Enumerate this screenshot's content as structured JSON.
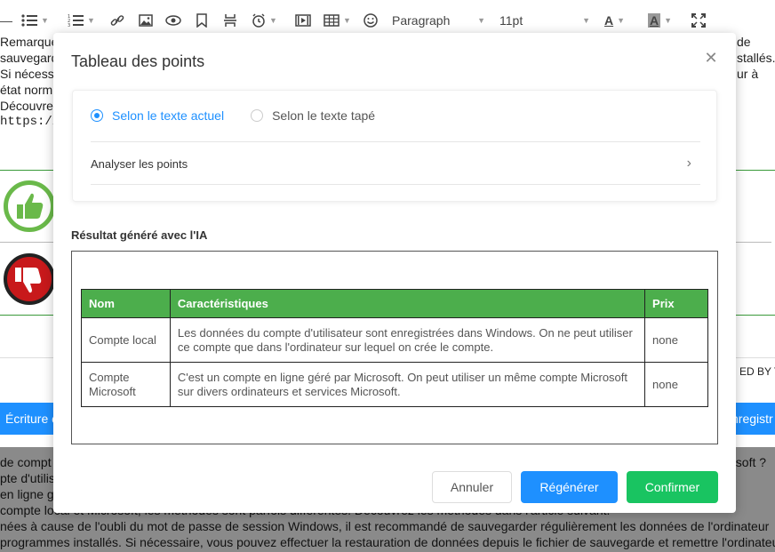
{
  "toolbar": {
    "paragraph": "Paragraph",
    "font_size": "11pt",
    "font_color_letter": "A",
    "highlight_letter": "A"
  },
  "background": {
    "lines_top": [
      "Remarque",
      "sauvegard",
      "Si nécess",
      "état norm",
      "Découvre",
      "https://w"
    ],
    "right_fragments": [
      "de",
      "stallés.",
      "ur à"
    ],
    "powered": "ED BY TI",
    "bar_left": "Écriture c",
    "bar_right": "nregistr",
    "gray_lines": [
      "de compt",
      "pte d'utilisa",
      "en ligne g",
      "compte local et Microsoft, les méthodes sont parfois différentes. Découvrez les méthodes dans l'article suivant.",
      "nées à cause de l'oubli du mot de passe de session Windows, il est recommandé de sauvegarder régulièrement les données de l'ordinateur",
      "programmes installés. Si nécessaire, vous pouvez effectuer la restauration de données depuis le fichier de sauvegarde et remettre l'ordinateur"
    ],
    "gray_right": "osoft ?"
  },
  "modal": {
    "title": "Tableau des points",
    "radio_options": [
      {
        "label": "Selon le texte actuel",
        "selected": true
      },
      {
        "label": "Selon le texte tapé",
        "selected": false
      }
    ],
    "analyze_label": "Analyser les points",
    "result_label": "Résultat généré avec l'IA",
    "table": {
      "headers": [
        "Nom",
        "Caractéristiques",
        "Prix"
      ],
      "rows": [
        [
          "Compte local",
          "Les données du compte d'utilisateur sont enregistrées dans Windows. On ne peut utiliser ce compte que dans l'ordinateur sur lequel on crée le compte.",
          "none"
        ],
        [
          "Compte Microsoft",
          "C'est un compte en ligne géré par Microsoft. On peut utiliser un même compte Microsoft sur divers ordinateurs et services Microsoft.",
          "none"
        ]
      ]
    },
    "buttons": {
      "cancel": "Annuler",
      "regenerate": "Régénérer",
      "confirm": "Confirmer"
    }
  },
  "colors": {
    "accent": "#1e90ff",
    "confirm": "#19c461",
    "table_header": "#4cae4c"
  }
}
